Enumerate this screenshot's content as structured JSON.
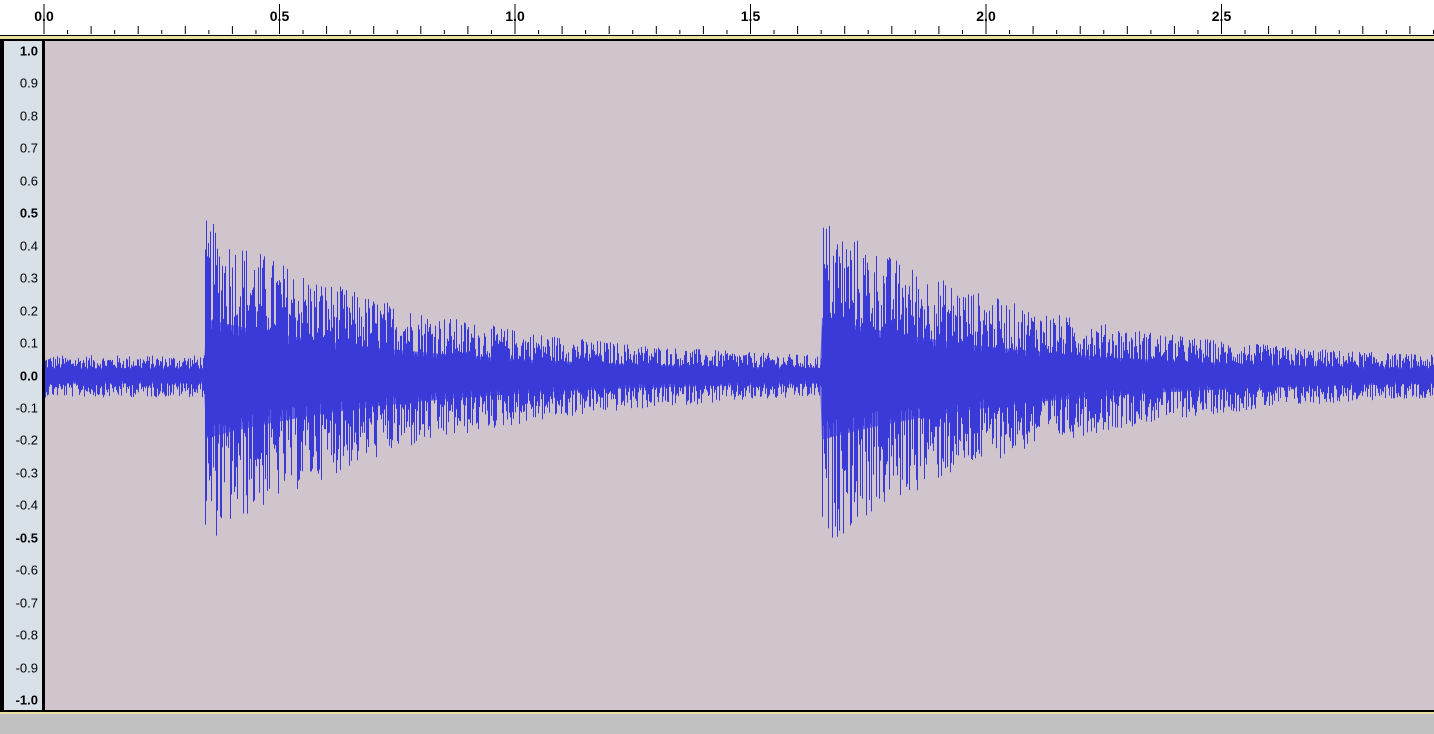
{
  "ruler": {
    "time_labels": [
      "0.0",
      "0.5",
      "1.0",
      "1.5",
      "2.0",
      "2.5"
    ],
    "time_values": [
      0.0,
      0.5,
      1.0,
      1.5,
      2.0,
      2.5
    ],
    "visible_range_seconds": [
      0.0,
      2.95
    ]
  },
  "amplitude_scale": {
    "labels": [
      "1.0",
      "0.9",
      "0.8",
      "0.7",
      "0.6",
      "0.5",
      "0.4",
      "0.3",
      "0.2",
      "0.1",
      "0.0",
      "-0.1",
      "-0.2",
      "-0.3",
      "-0.4",
      "-0.5",
      "-0.6",
      "-0.7",
      "-0.8",
      "-0.9",
      "-1.0"
    ],
    "values": [
      1.0,
      0.9,
      0.8,
      0.7,
      0.6,
      0.5,
      0.4,
      0.3,
      0.2,
      0.1,
      0.0,
      -0.1,
      -0.2,
      -0.3,
      -0.4,
      -0.5,
      -0.6,
      -0.7,
      -0.8,
      -0.9,
      -1.0
    ],
    "bold_labels": [
      "1.0",
      "0.5",
      "0.0",
      "-0.5",
      "-1.0"
    ]
  },
  "waveform": {
    "color": "#3a3ad8",
    "fill_color": "#6060e0",
    "background_color": "#d0c5cd",
    "bursts": [
      {
        "onset_seconds": 0.34,
        "peak_amplitude": 0.43,
        "trough_amplitude": -0.48
      },
      {
        "onset_seconds": 1.65,
        "peak_amplitude": 0.44,
        "trough_amplitude": -0.49
      }
    ],
    "noise_floor_amplitude": 0.05
  }
}
